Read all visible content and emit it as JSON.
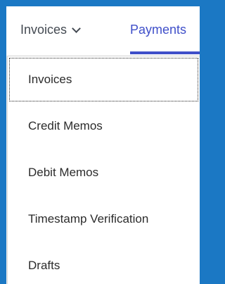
{
  "tabs": {
    "invoices_label": "Invoices",
    "payments_label": "Payments"
  },
  "menu": {
    "items": [
      {
        "label": "Invoices"
      },
      {
        "label": "Credit Memos"
      },
      {
        "label": "Debit Memos"
      },
      {
        "label": "Timestamp Verification"
      },
      {
        "label": "Drafts"
      }
    ]
  },
  "colors": {
    "frame": "#1b78c4",
    "active_tab": "#3f4fc9",
    "text": "#444a52"
  },
  "icons": {
    "dropdown": "chevron-down-icon"
  }
}
